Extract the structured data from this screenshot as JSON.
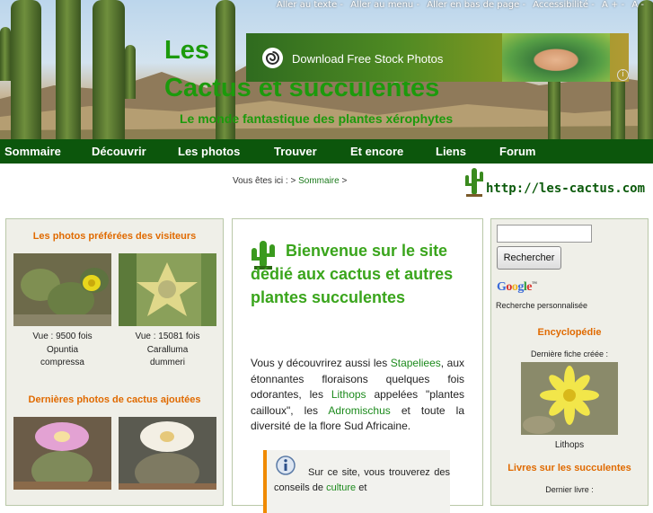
{
  "accessibility_links": [
    "Aller au texte",
    "Aller au menu",
    "Aller en bas de page",
    "Accessibilité",
    "A +",
    "A -"
  ],
  "site": {
    "title_line1": "Les",
    "title_line2": "Cactus et succulentes",
    "tagline": "Le monde fantastique des plantes xérophytes",
    "url": "http://les-cactus.com"
  },
  "ad": {
    "text": "Download Free Stock Photos",
    "info_icon": "i"
  },
  "nav": [
    "Sommaire",
    "Découvrir",
    "Les photos",
    "Trouver",
    "Et encore",
    "Liens",
    "Forum"
  ],
  "breadcrumb": {
    "prefix": "Vous êtes ici : >",
    "link": "Sommaire",
    "suffix": ">"
  },
  "left": {
    "favorites_title": "Les photos préférées des visiteurs",
    "favorites": [
      {
        "views": "Vue : 9500 fois",
        "name_line1": "Opuntia",
        "name_line2": "compressa"
      },
      {
        "views": "Vue : 15081 fois",
        "name_line1": "Caralluma",
        "name_line2": "dummeri"
      }
    ],
    "latest_title": "Dernières photos de cactus ajoutées"
  },
  "center": {
    "welcome": "Bienvenue sur le site dédié aux cactus et autres plantes succulentes",
    "intro_parts": [
      "Vous y découvrirez aussi les ",
      "Stapeliees",
      ", aux étonnantes floraisons quelques fois odorantes, les ",
      "Lithops",
      " appelées \"plantes cailloux\", les ",
      "Adromischus",
      " et toute la diversité de la flore Sud Africaine."
    ],
    "info_text": "Sur ce site, vous trouverez des conseils de",
    "info_link1": "culture",
    "info_link2": "et"
  },
  "right": {
    "search_button": "Rechercher",
    "search_value": "",
    "google_sub": "Recherche personnalisée",
    "encyclopedia_title": "Encyclopédie",
    "last_sheet_label": "Dernière fiche créée :",
    "last_sheet_name": "Lithops",
    "books_title": "Livres sur les succulentes",
    "last_book_label": "Dernier livre :"
  },
  "colors": {
    "nav_bg": "#0c560c",
    "title_green": "#1c9a0c",
    "section_orange": "#e06a00",
    "link_green": "#1c8a1c"
  }
}
